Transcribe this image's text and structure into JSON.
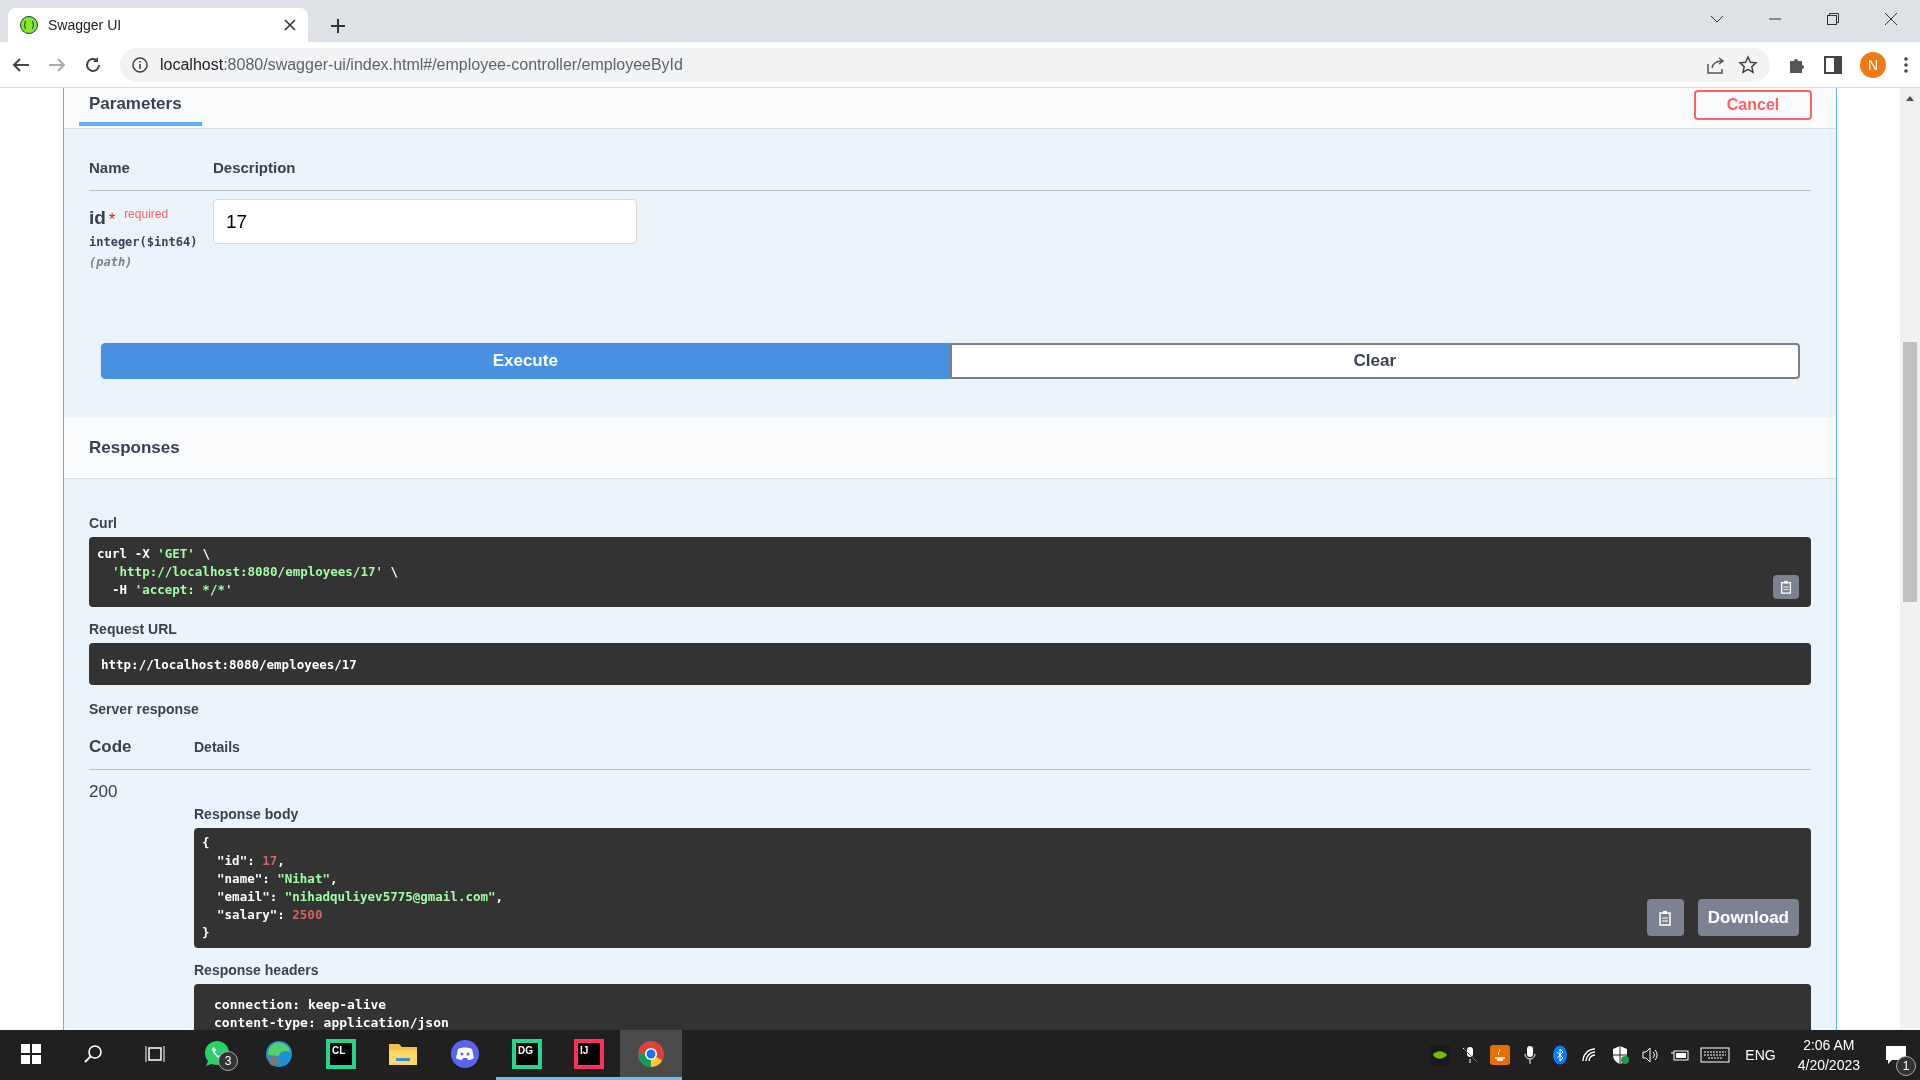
{
  "browser": {
    "tab_title": "Swagger UI",
    "url_host": "localhost",
    "url_rest": ":8080/swagger-ui/index.html#/employee-controller/employeeById",
    "profile": "N"
  },
  "parameters": {
    "tab": "Parameters",
    "cancel": "Cancel",
    "col_name": "Name",
    "col_description": "Description",
    "items": [
      {
        "name": "id",
        "required_mark": "*",
        "required": "required",
        "type": "integer($int64)",
        "location": "(path)",
        "value": "17"
      }
    ]
  },
  "buttons": {
    "execute": "Execute",
    "clear": "Clear"
  },
  "responses": {
    "title": "Responses",
    "curl_label": "Curl",
    "curl_lines": [
      {
        "indent": false,
        "tokens": [
          {
            "kind": "plain",
            "text": "curl -X "
          },
          {
            "kind": "string",
            "text": "'GET'"
          },
          {
            "kind": "plain",
            "text": " \\"
          }
        ]
      },
      {
        "indent": true,
        "tokens": [
          {
            "kind": "string",
            "text": "'http://localhost:8080/employees/17'"
          },
          {
            "kind": "plain",
            "text": " \\"
          }
        ]
      },
      {
        "indent": true,
        "tokens": [
          {
            "kind": "plain",
            "text": "-H "
          },
          {
            "kind": "string",
            "text": "'accept: */*'"
          }
        ]
      }
    ],
    "request_url_label": "Request URL",
    "request_url": "http://localhost:8080/employees/17",
    "server_response": "Server response",
    "col_code": "Code",
    "col_details": "Details",
    "code": "200",
    "body_label": "Response body",
    "body_lines": [
      [
        {
          "kind": "plain",
          "text": "{"
        }
      ],
      [
        {
          "kind": "plain",
          "text": "  \"id\": "
        },
        {
          "kind": "number",
          "text": "17"
        },
        {
          "kind": "plain",
          "text": ","
        }
      ],
      [
        {
          "kind": "plain",
          "text": "  \"name\": "
        },
        {
          "kind": "string",
          "text": "\"Nihat\""
        },
        {
          "kind": "plain",
          "text": ","
        }
      ],
      [
        {
          "kind": "plain",
          "text": "  \"email\": "
        },
        {
          "kind": "string",
          "text": "\"nihadquliyev5775@gmail.com\""
        },
        {
          "kind": "plain",
          "text": ","
        }
      ],
      [
        {
          "kind": "plain",
          "text": "  \"salary\": "
        },
        {
          "kind": "number",
          "text": "2500"
        }
      ],
      [
        {
          "kind": "plain",
          "text": "}"
        }
      ]
    ],
    "download": "Download",
    "headers_label": "Response headers",
    "header_lines": [
      "connection: keep-alive",
      "content-type: application/json"
    ]
  },
  "taskbar": {
    "apps": [
      {
        "kind": "whatsapp",
        "badge": "3",
        "running": false,
        "active": false
      },
      {
        "kind": "edge",
        "running": false,
        "active": false
      },
      {
        "kind": "jetbrains",
        "label": "CL",
        "color": "#21d789",
        "running": false,
        "active": false
      },
      {
        "kind": "folder",
        "running": false,
        "active": false
      },
      {
        "kind": "discord",
        "running": false,
        "active": false
      },
      {
        "kind": "jetbrains",
        "label": "DG",
        "color": "#22d88f",
        "running": true,
        "active": false
      },
      {
        "kind": "jetbrains",
        "label": "IJ",
        "color": "#fe315d",
        "running": true,
        "active": false
      },
      {
        "kind": "chrome",
        "running": true,
        "active": true
      }
    ],
    "tray": [
      {
        "kind": "nvidia"
      },
      {
        "kind": "mic-muted"
      },
      {
        "kind": "java"
      },
      {
        "kind": "mic"
      },
      {
        "kind": "bluetooth"
      },
      {
        "kind": "wifi"
      },
      {
        "kind": "shield"
      },
      {
        "kind": "volume"
      },
      {
        "kind": "battery"
      },
      {
        "kind": "keyboard"
      }
    ],
    "language": "ENG",
    "time": "2:06 AM",
    "date": "4/20/2023",
    "notifications": "1"
  }
}
